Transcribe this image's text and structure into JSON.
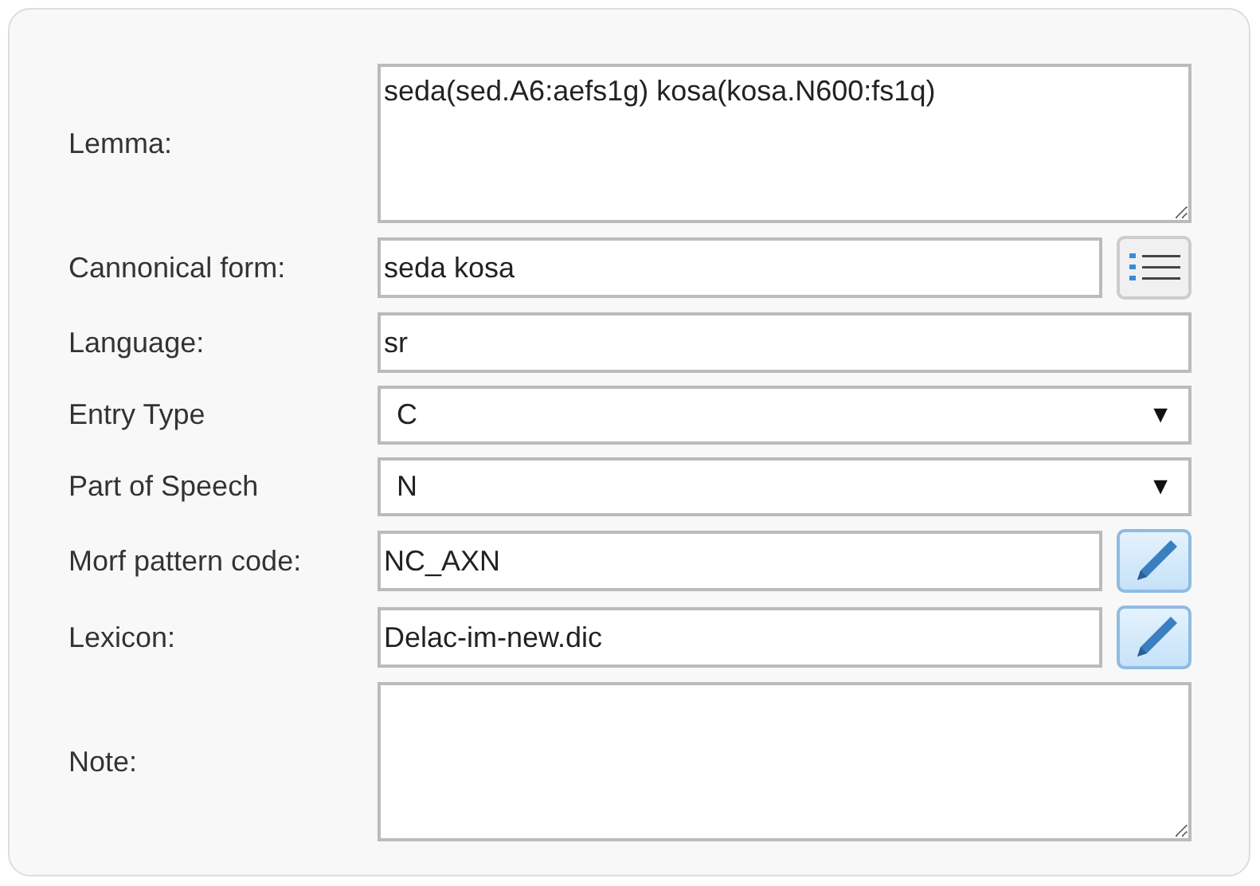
{
  "fields": [
    {
      "label": "Lemma:",
      "kind": "textarea",
      "value": "seda(sed.A6:aefs1g) kosa(kosa.N600:fs1q)"
    },
    {
      "label": "Cannonical form:",
      "kind": "input",
      "value": "seda kosa",
      "button": {
        "kind": "list"
      }
    },
    {
      "label": "Language:",
      "kind": "input",
      "value": "sr"
    },
    {
      "label": "Entry Type",
      "kind": "select",
      "value": "C",
      "arrow": "▼"
    },
    {
      "label": "Part of Speech",
      "kind": "select",
      "value": "N",
      "arrow": "▼"
    },
    {
      "label": "Morf pattern code:",
      "kind": "input",
      "value": "NC_AXN",
      "button": {
        "kind": "edit"
      }
    },
    {
      "label": "Lexicon:",
      "kind": "input",
      "value": "Delac-im-new.dic",
      "button": {
        "kind": "edit"
      }
    },
    {
      "label": "Note:",
      "kind": "textarea"
    }
  ]
}
